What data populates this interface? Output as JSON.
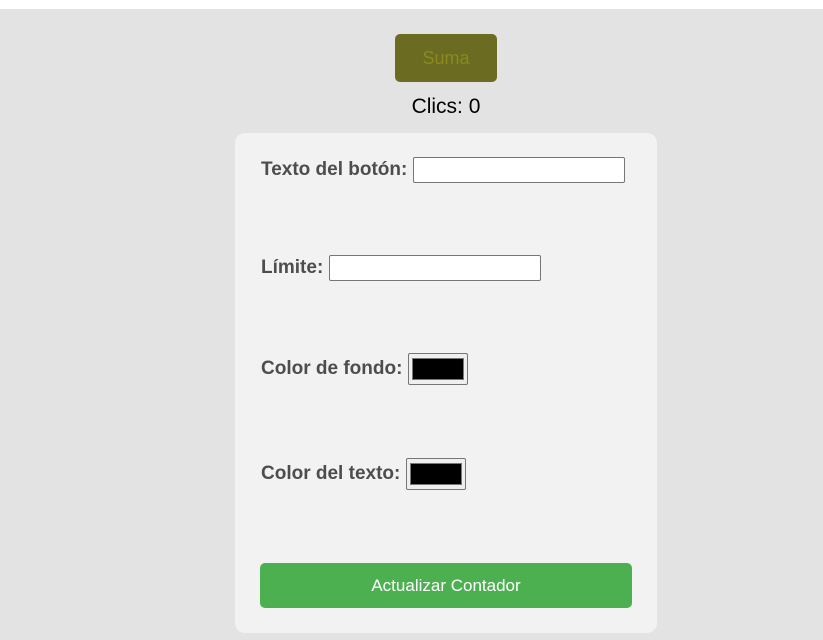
{
  "counter": {
    "button_label": "Suma",
    "clicks_text": "Clics: 0",
    "button_bg_color": "#6b6b22",
    "button_text_color": "#8a8a1e"
  },
  "form": {
    "button_text_label": "Texto del botón:",
    "button_text_value": "",
    "limit_label": "Límite:",
    "limit_value": "",
    "bg_color_label": "Color de fondo:",
    "bg_color_value": "#000000",
    "text_color_label": "Color del texto:",
    "text_color_value": "#000000",
    "submit_label": "Actualizar Contador",
    "submit_color": "#4caf50"
  }
}
